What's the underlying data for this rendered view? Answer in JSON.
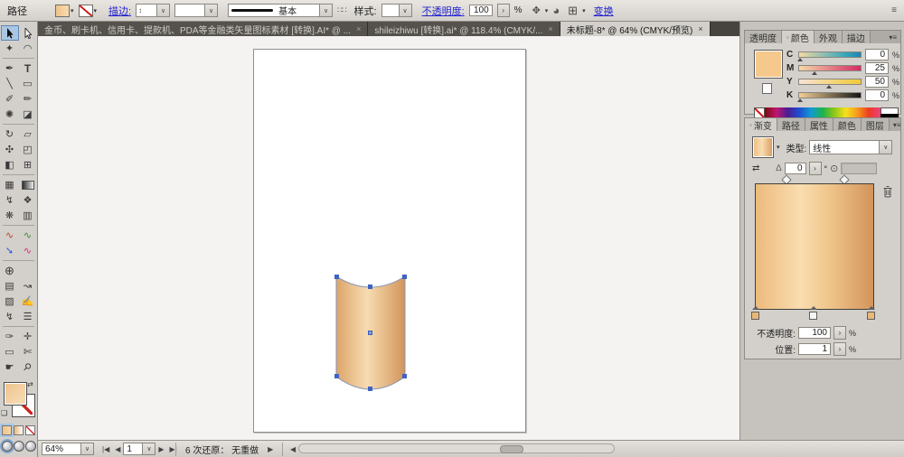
{
  "control_bar": {
    "selection_label": "路径",
    "stroke_link": "描边:",
    "brush_name": "基本",
    "style_label": "样式:",
    "opacity_link": "不透明度:",
    "opacity_value": "100",
    "opacity_unit": "%",
    "transform_link": "变换"
  },
  "document_tabs": [
    {
      "title": "金币、刷卡机、信用卡、提款机、PDA等金融类矢量图标素材 [转换].AI* @ ...",
      "close": "×"
    },
    {
      "title": "shileizhiwu [转换].ai* @ 118.4% (CMYK/...",
      "close": "×"
    },
    {
      "title": "未标题-8* @ 64% (CMYK/预览)",
      "close": "×"
    }
  ],
  "color_panel": {
    "tabs": [
      "透明度",
      "颜色",
      "外观",
      "描边"
    ],
    "active_tab": "颜色",
    "channels": [
      {
        "label": "C",
        "value": "0",
        "unit": "%"
      },
      {
        "label": "M",
        "value": "25",
        "unit": "%"
      },
      {
        "label": "Y",
        "value": "50",
        "unit": "%"
      },
      {
        "label": "K",
        "value": "0",
        "unit": "%"
      }
    ]
  },
  "gradient_panel": {
    "tabs": [
      "渐变",
      "路径",
      "属性",
      "颜色",
      "图层"
    ],
    "active_tab": "渐变",
    "type_label": "类型:",
    "type_value": "线性",
    "angle_value": "0",
    "degree": "°",
    "opacity_label": "不透明度:",
    "opacity_value": "100",
    "location_label": "位置:",
    "location_value": "1",
    "unit": "%"
  },
  "status_bar": {
    "zoom_value": "64%",
    "page_value": "1",
    "undo_status": "6 次还原： 无重做"
  },
  "colors": {
    "accent_tan": "#f2c484",
    "gradient_left": "#ecba7c",
    "gradient_mid": "#f9ddb0",
    "gradient_right": "#d3945a",
    "selection_blue": "#3e63c4",
    "link_blue": "#2424d0",
    "tab_bar_dark": "#47443f",
    "panel_gray": "#d3d0cb"
  },
  "icons": {
    "dropdown": "∨",
    "dropdown_small": "▾",
    "spinner_right": "›",
    "spinner_updown": "↕",
    "menu_bars": "≡",
    "panel_menu": "▾≡",
    "panel_dot": "◦",
    "magic_wand": "✦",
    "lasso": "◠",
    "pen": "✒",
    "type": "T",
    "line": "╲",
    "rectangle": "▭",
    "paintbrush": "✐",
    "pencil": "✏",
    "blob_brush": "✺",
    "eraser": "◪",
    "rotate": "↻",
    "scale": "▱",
    "width": "✣",
    "free_transform": "◰",
    "shape_builder": "◧",
    "perspective_grid": "⊞",
    "mesh": "▦",
    "eyedropper": "↯",
    "blend": "❖",
    "symbol_sprayer": "❋",
    "column_graph": "▥",
    "arc": "∿",
    "spiral": "∿",
    "curvature": "➘",
    "wave": "∿",
    "artboard": "⊕",
    "slice": "▤",
    "slice_select": "↝",
    "graph": "▨",
    "sketch": "✍",
    "squiggle": "↯",
    "list": "☰",
    "eyedropper_alt": "✑",
    "measure": "✛",
    "frame": "▭",
    "knife": "✄",
    "hand": "☛",
    "zoom": "⚲",
    "swap": "⇄",
    "default_swatches": "❏",
    "style_dots": "∷∷",
    "select_similar": "✥",
    "recolor": "◕",
    "reference_point": "⊞",
    "reverse_gradient": "⇄",
    "angle": "∆",
    "annotator": "⊙",
    "nav_first": "|◀",
    "nav_prev": "◀",
    "nav_next": "▶",
    "nav_last": "▶|",
    "expand": "▶",
    "scroll_left": "◀"
  }
}
